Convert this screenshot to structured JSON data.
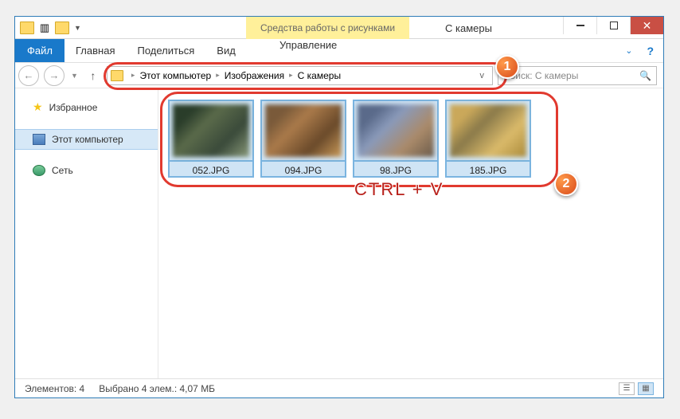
{
  "titlebar": {
    "context_tab": "Средства работы с рисунками",
    "title": "С камеры"
  },
  "ribbon": {
    "file": "Файл",
    "tabs": [
      "Главная",
      "Поделиться",
      "Вид"
    ],
    "manage": "Управление"
  },
  "nav": {
    "breadcrumb": [
      "Этот компьютер",
      "Изображения",
      "С камеры"
    ],
    "refresh_symbol": "v"
  },
  "search": {
    "placeholder": "Поиск: С камеры"
  },
  "sidebar": {
    "favorites": "Избранное",
    "computer": "Этот компьютер",
    "network": "Сеть"
  },
  "files": [
    {
      "name": "052.JPG"
    },
    {
      "name": "094.JPG"
    },
    {
      "name": "98.JPG"
    },
    {
      "name": "185.JPG"
    }
  ],
  "annotation": {
    "shortcut": "CTRL + V",
    "badge1": "1",
    "badge2": "2"
  },
  "status": {
    "count": "Элементов: 4",
    "selection": "Выбрано 4 элем.: 4,07 МБ"
  }
}
